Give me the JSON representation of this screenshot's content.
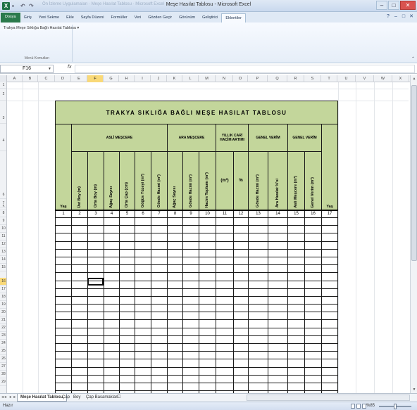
{
  "window": {
    "title": "Meşe Hasılat Tablosu - Microsoft Excel",
    "ghost_title": "Ön İzleme Uygulamaları · Meşe Hasılat Tablosu · Microsoft Excel",
    "controls": [
      "–",
      "□",
      "✕"
    ]
  },
  "ribbon": {
    "tabs": [
      "Dosya",
      "Giriş",
      "Yeni Sekme",
      "Ekle",
      "Sayfa Düzeni",
      "Formüller",
      "Veri",
      "Gözden Geçir",
      "Görünüm",
      "Geliştirici",
      "Eklentiler"
    ],
    "active_tab": "Eklentiler",
    "right_icons": [
      "?",
      "–",
      "□",
      "✕"
    ],
    "group_command": "Trakya Meşe Sıklığa Bağlı Hasılat Tablosu ▾",
    "group_name": "Menü Komutları"
  },
  "formula_bar": {
    "name_box": "F16",
    "fx": "fx",
    "value": ""
  },
  "columns": [
    "A",
    "B",
    "C",
    "D",
    "E",
    "F",
    "G",
    "H",
    "I",
    "J",
    "K",
    "L",
    "M",
    "N",
    "O",
    "P",
    "Q",
    "R",
    "S",
    "T",
    "U",
    "V",
    "W",
    "X",
    "Y"
  ],
  "selected_column": "F",
  "rows": [
    "1",
    "2",
    "3",
    "4",
    "5",
    "6",
    "7",
    "8",
    "9",
    "10",
    "11",
    "12",
    "13",
    "14",
    "15",
    "16",
    "17",
    "18",
    "19",
    "20",
    "21",
    "22",
    "23",
    "24",
    "25",
    "26",
    "27",
    "28",
    "29"
  ],
  "selected_row": "16",
  "sheet": {
    "title": "TRAKYA SIKLIĞA BAĞLI MEŞE HASILAT TABLOSU",
    "groups": {
      "asli": "ASLİ MEŞCERE",
      "ara": "ARA MEŞCERE",
      "artim": "YILLIK CARİ HACİM ARTIMI",
      "genel1": "GENEL VERİM",
      "genel2": "GENEL VERİM"
    },
    "yas": "Yaş",
    "columns": [
      "Üst Boy (m)",
      "Orta Boy (m)",
      "Ağaç Sayısı",
      "Orta Çap (cm)",
      "Göğüs Yüzeyi (m²)",
      "Gövde Hacmi (m³)",
      "Ağaç Sayısı",
      "Gövde Hacmi (m³)",
      "Hacim Toplamı (m³)",
      "(m³)",
      "%",
      "Gövde Hacmi (m³)",
      "Ara Hasılat %'si",
      "Asli Meşcere (m³)",
      "Genel Verim (m³)"
    ],
    "numbers": [
      "1",
      "2",
      "3",
      "4",
      "5",
      "6",
      "7",
      "8",
      "9",
      "10",
      "11",
      "12",
      "13",
      "14",
      "15",
      "16",
      "17"
    ]
  },
  "sheet_tabs": [
    "Meşe Hasılat Tablosu",
    "Çap",
    "Boy",
    "Çap Basamakları"
  ],
  "active_sheet": "Meşe Hasılat Tablosu",
  "status": {
    "ready": "Hazır",
    "zoom": "%85"
  }
}
